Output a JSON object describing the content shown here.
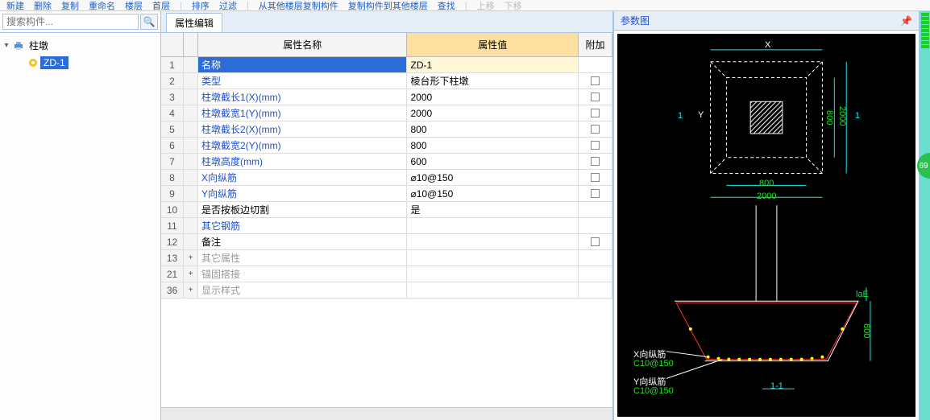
{
  "toolbar": {
    "items": [
      "新建",
      "删除",
      "复制",
      "重命名",
      "楼层",
      "首层",
      "排序",
      "过滤",
      "从其他楼层复制构件",
      "复制构件到其他楼层",
      "查找",
      "上移",
      "下移"
    ]
  },
  "search": {
    "placeholder": "搜索构件..."
  },
  "tree": {
    "root_label": "柱墩",
    "child_label": "ZD-1"
  },
  "center": {
    "tab": "属性编辑",
    "headers": {
      "name": "属性名称",
      "value": "属性值",
      "extra": "附加"
    },
    "rows": [
      {
        "num": "1",
        "exp": "",
        "name": "名称",
        "value": "ZD-1",
        "link": false,
        "chk": null,
        "sel": true
      },
      {
        "num": "2",
        "exp": "",
        "name": "类型",
        "value": "棱台形下柱墩",
        "link": true,
        "chk": false
      },
      {
        "num": "3",
        "exp": "",
        "name": "柱墩截长1(X)(mm)",
        "value": "2000",
        "link": true,
        "chk": false
      },
      {
        "num": "4",
        "exp": "",
        "name": "柱墩截宽1(Y)(mm)",
        "value": "2000",
        "link": true,
        "chk": false
      },
      {
        "num": "5",
        "exp": "",
        "name": "柱墩截长2(X)(mm)",
        "value": "800",
        "link": true,
        "chk": false
      },
      {
        "num": "6",
        "exp": "",
        "name": "柱墩截宽2(Y)(mm)",
        "value": "800",
        "link": true,
        "chk": false
      },
      {
        "num": "7",
        "exp": "",
        "name": "柱墩高度(mm)",
        "value": "600",
        "link": true,
        "chk": false
      },
      {
        "num": "8",
        "exp": "",
        "name": "X向纵筋",
        "value": "⌀10@150",
        "link": true,
        "chk": false
      },
      {
        "num": "9",
        "exp": "",
        "name": "Y向纵筋",
        "value": "⌀10@150",
        "link": true,
        "chk": false
      },
      {
        "num": "10",
        "exp": "",
        "name": "是否按板边切割",
        "value": "是",
        "link": false,
        "chk": null
      },
      {
        "num": "11",
        "exp": "",
        "name": "其它钢筋",
        "value": "",
        "link": true,
        "chk": null
      },
      {
        "num": "12",
        "exp": "",
        "name": "备注",
        "value": "",
        "link": false,
        "chk": false
      },
      {
        "num": "13",
        "exp": "+",
        "name": "其它属性",
        "value": "",
        "link": false,
        "chk": null,
        "muted": true
      },
      {
        "num": "21",
        "exp": "+",
        "name": "锚固搭接",
        "value": "",
        "link": false,
        "chk": null,
        "muted": true
      },
      {
        "num": "36",
        "exp": "+",
        "name": "显示样式",
        "value": "",
        "link": false,
        "chk": null,
        "muted": true
      }
    ]
  },
  "right": {
    "title": "参数图",
    "pin": "📌",
    "dims": {
      "x": "X",
      "y": "Y",
      "w2": "800",
      "w1": "2000",
      "h2": "800",
      "h1": "2000",
      "one_left": "1",
      "one_right": "1",
      "xlabel": "X向纵筋",
      "xval": "C10@150",
      "ylabel": "Y向纵筋",
      "yval": "C10@150",
      "height": "600",
      "lae": "laE",
      "section": "1-1"
    }
  },
  "bubble": "69"
}
